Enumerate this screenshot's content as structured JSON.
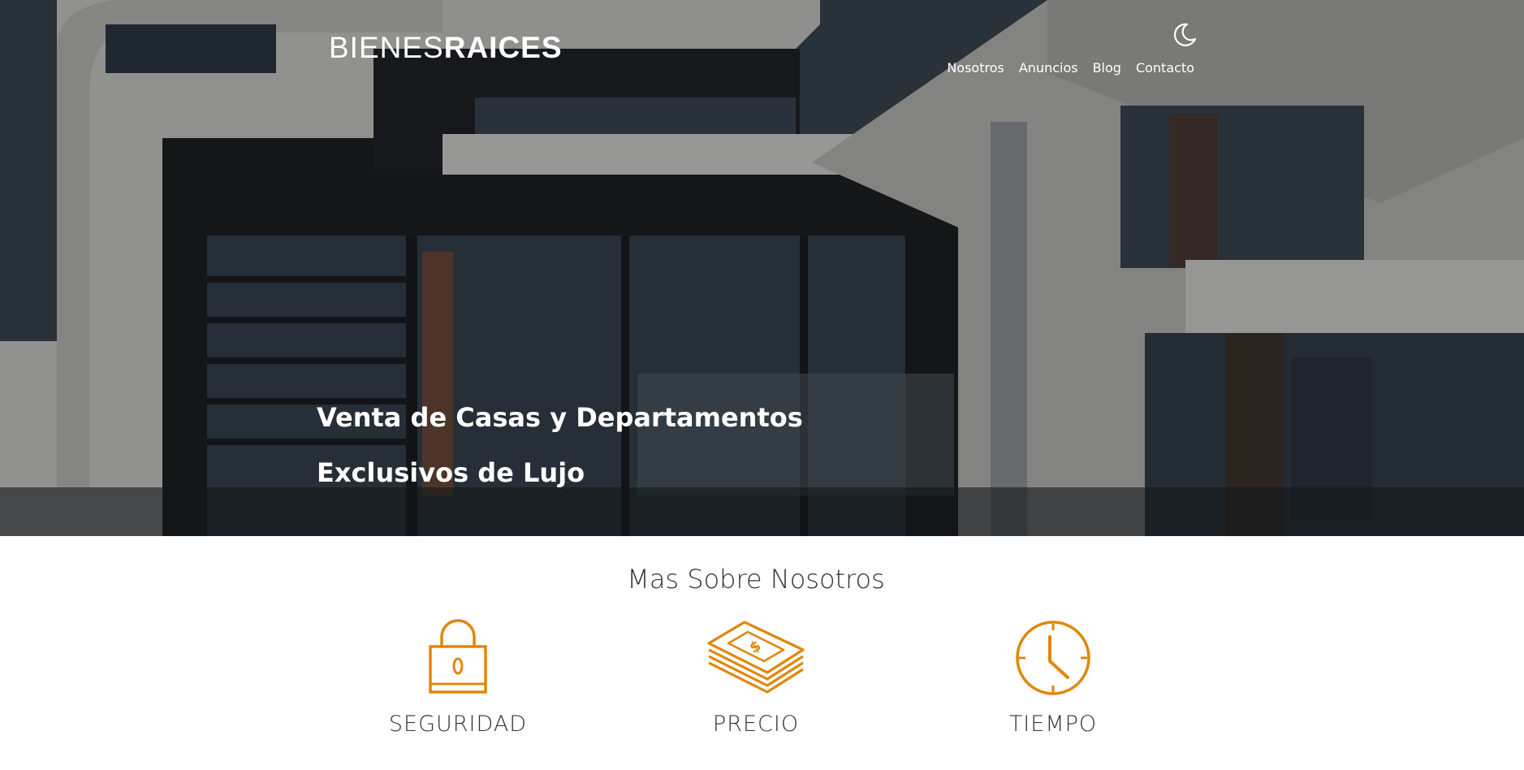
{
  "header": {
    "logo_light": "BIENES",
    "logo_bold": "RAICES",
    "dark_mode_icon": "moon-icon",
    "nav": [
      {
        "label": "Nosotros"
      },
      {
        "label": "Anuncios"
      },
      {
        "label": "Blog"
      },
      {
        "label": "Contacto"
      }
    ]
  },
  "hero": {
    "title_line1": "Venta de Casas y Departamentos",
    "title_line2": "Exclusivos de Lujo"
  },
  "about": {
    "title": "Mas Sobre Nosotros",
    "features": [
      {
        "icon": "lock-icon",
        "label": "SEGURIDAD"
      },
      {
        "icon": "money-stack-icon",
        "label": "PRECIO"
      },
      {
        "icon": "clock-icon",
        "label": "TIEMPO"
      }
    ]
  },
  "colors": {
    "accent": "#e08709",
    "text": "#333333",
    "white": "#ffffff"
  }
}
